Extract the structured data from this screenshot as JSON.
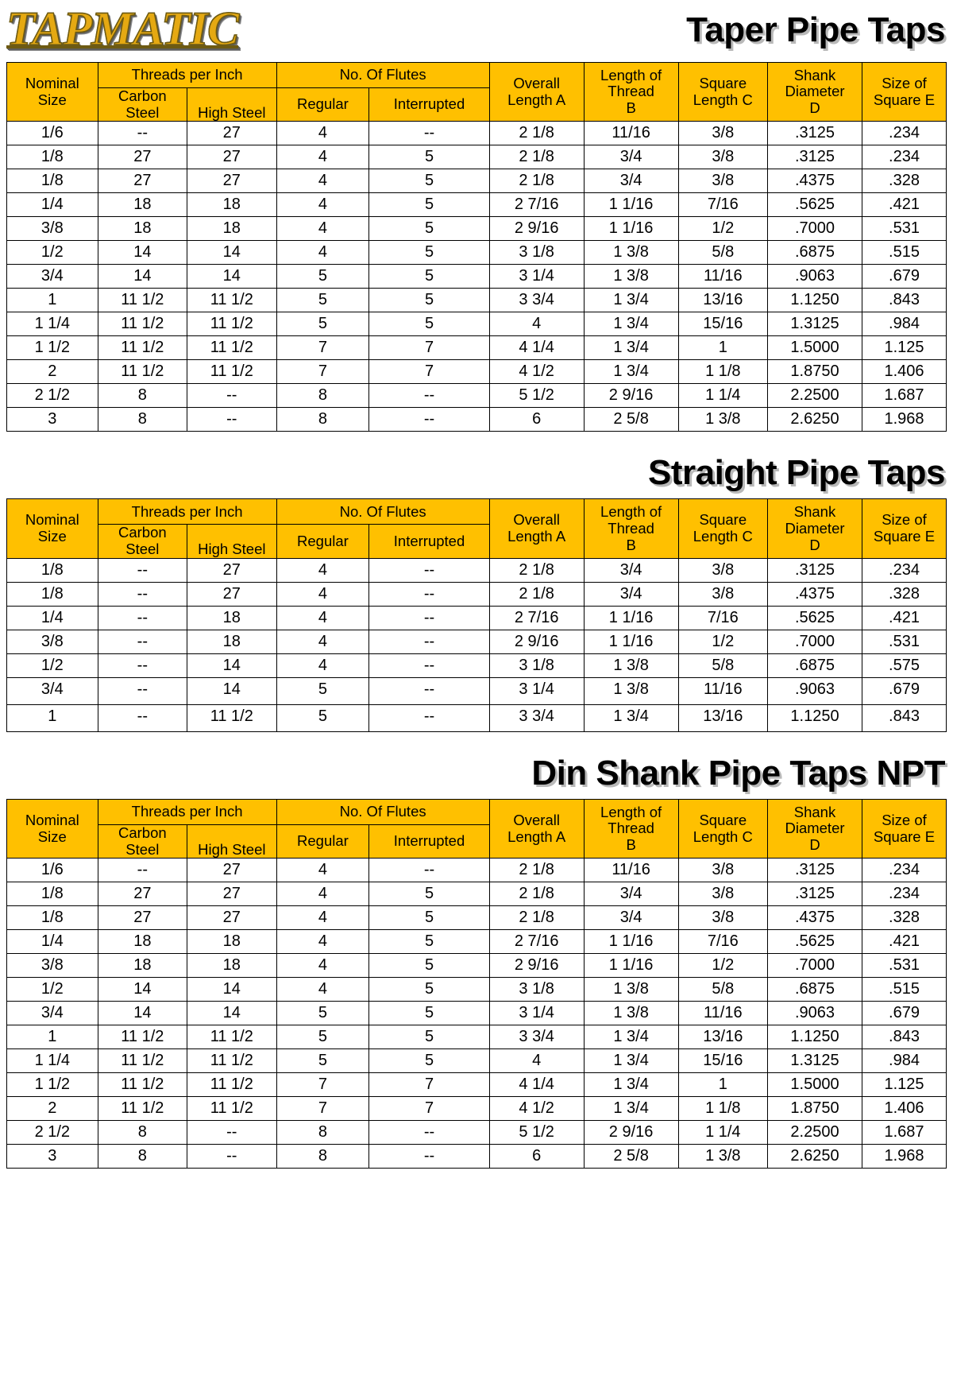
{
  "brand": {
    "logo_text": "TAPMATIC"
  },
  "columns": {
    "nominal_size": "Nominal\nSize",
    "nominal_size_l1": "Nominal",
    "nominal_size_l2": "Size",
    "threads_per_inch": "Threads per Inch",
    "carbon_steel_l1": "Carbon",
    "carbon_steel_l2": "Steel",
    "high_steel": "High Steel",
    "no_of_flutes": "No. Of Flutes",
    "regular": "Regular",
    "interrupted": "Interrupted",
    "overall_l1": "Overall",
    "overall_l2": "Length A",
    "thread_l1": "Length of",
    "thread_l2": "Thread",
    "thread_l3": "B",
    "square_l1": "Square",
    "square_l2": "Length C",
    "shank_l1": "Shank",
    "shank_l2": "Diameter",
    "shank_l3": "D",
    "sqe_l1": "Size of",
    "sqe_l2": "Square E"
  },
  "colors": {
    "header_bg": "#FFC000",
    "shaded_row": "#AFAFAF",
    "logo_gold": "#E5A912",
    "text": "#000000"
  },
  "sections": [
    {
      "id": "taper-pipe-taps",
      "title": "Taper Pipe Taps",
      "rows": [
        {
          "shaded": false,
          "cells": [
            "1/6",
            "--",
            "27",
            "4",
            "--",
            "2 1/8",
            "11/16",
            "3/8",
            ".3125",
            ".234"
          ]
        },
        {
          "shaded": false,
          "cells": [
            "1/8",
            "27",
            "27",
            "4",
            "5",
            "2 1/8",
            "3/4",
            "3/8",
            ".3125",
            ".234"
          ]
        },
        {
          "shaded": true,
          "cells": [
            "1/8",
            "27",
            "27",
            "4",
            "5",
            "2 1/8",
            "3/4",
            "3/8",
            ".4375",
            ".328"
          ]
        },
        {
          "shaded": true,
          "cells": [
            "1/4",
            "18",
            "18",
            "4",
            "5",
            "2 7/16",
            "1 1/16",
            "7/16",
            ".5625",
            ".421"
          ]
        },
        {
          "shaded": false,
          "cells": [
            "3/8",
            "18",
            "18",
            "4",
            "5",
            "2 9/16",
            "1 1/16",
            "1/2",
            ".7000",
            ".531"
          ]
        },
        {
          "shaded": false,
          "cells": [
            "1/2",
            "14",
            "14",
            "4",
            "5",
            "3 1/8",
            "1 3/8",
            "5/8",
            ".6875",
            ".515"
          ]
        },
        {
          "shaded": true,
          "cells": [
            "3/4",
            "14",
            "14",
            "5",
            "5",
            "3 1/4",
            "1 3/8",
            "11/16",
            ".9063",
            ".679"
          ]
        },
        {
          "shaded": true,
          "cells": [
            "1",
            "11 1/2",
            "11 1/2",
            "5",
            "5",
            "3 3/4",
            "1 3/4",
            "13/16",
            "1.1250",
            ".843"
          ]
        },
        {
          "shaded": false,
          "cells": [
            "1 1/4",
            "11 1/2",
            "11 1/2",
            "5",
            "5",
            "4",
            "1 3/4",
            "15/16",
            "1.3125",
            ".984"
          ]
        },
        {
          "shaded": false,
          "cells": [
            "1 1/2",
            "11 1/2",
            "11 1/2",
            "7",
            "7",
            "4 1/4",
            "1 3/4",
            "1",
            "1.5000",
            "1.125"
          ]
        },
        {
          "shaded": true,
          "cells": [
            "2",
            "11 1/2",
            "11 1/2",
            "7",
            "7",
            "4 1/2",
            "1 3/4",
            "1 1/8",
            "1.8750",
            "1.406"
          ]
        },
        {
          "shaded": true,
          "cells": [
            "2 1/2",
            "8",
            "--",
            "8",
            "--",
            "5 1/2",
            "2 9/16",
            "1 1/4",
            "2.2500",
            "1.687"
          ]
        },
        {
          "shaded": false,
          "cells": [
            "3",
            "8",
            "--",
            "8",
            "--",
            "6",
            "2 5/8",
            "1 3/8",
            "2.6250",
            "1.968"
          ]
        }
      ]
    },
    {
      "id": "straight-pipe-taps",
      "title": "Straight Pipe Taps",
      "rows": [
        {
          "shaded": false,
          "cells": [
            "1/8",
            "--",
            "27",
            "4",
            "--",
            "2 1/8",
            "3/4",
            "3/8",
            ".3125",
            ".234"
          ]
        },
        {
          "shaded": false,
          "cells": [
            "1/8",
            "--",
            "27",
            "4",
            "--",
            "2 1/8",
            "3/4",
            "3/8",
            ".4375",
            ".328"
          ]
        },
        {
          "shaded": true,
          "cells": [
            "1/4",
            "--",
            "18",
            "4",
            "--",
            "2 7/16",
            "1 1/16",
            "7/16",
            ".5625",
            ".421"
          ]
        },
        {
          "shaded": true,
          "cells": [
            "3/8",
            "--",
            "18",
            "4",
            "--",
            "2 9/16",
            "1 1/16",
            "1/2",
            ".7000",
            ".531"
          ]
        },
        {
          "shaded": false,
          "cells": [
            "1/2",
            "--",
            "14",
            "4",
            "--",
            "3 1/8",
            "1 3/8",
            "5/8",
            ".6875",
            ".575"
          ]
        },
        {
          "shaded": true,
          "tall": "bottom",
          "cells": [
            "3/4",
            "--",
            "14",
            "5",
            "--",
            "3 1/4",
            "1 3/8",
            "11/16",
            ".9063",
            ".679"
          ]
        },
        {
          "shaded": true,
          "tall": "bottom",
          "cells": [
            "1",
            "--",
            "11 1/2",
            "5",
            "--",
            "3 3/4",
            "1 3/4",
            "13/16",
            "1.1250",
            ".843"
          ]
        }
      ]
    },
    {
      "id": "din-shank-pipe-taps-npt",
      "title": "Din Shank Pipe Taps NPT",
      "rows": [
        {
          "shaded": false,
          "cells": [
            "1/6",
            "--",
            "27",
            "4",
            "--",
            "2 1/8",
            "11/16",
            "3/8",
            ".3125",
            ".234"
          ]
        },
        {
          "shaded": false,
          "cells": [
            "1/8",
            "27",
            "27",
            "4",
            "5",
            "2 1/8",
            "3/4",
            "3/8",
            ".3125",
            ".234"
          ]
        },
        {
          "shaded": true,
          "cells": [
            "1/8",
            "27",
            "27",
            "4",
            "5",
            "2 1/8",
            "3/4",
            "3/8",
            ".4375",
            ".328"
          ]
        },
        {
          "shaded": true,
          "cells": [
            "1/4",
            "18",
            "18",
            "4",
            "5",
            "2 7/16",
            "1 1/16",
            "7/16",
            ".5625",
            ".421"
          ]
        },
        {
          "shaded": false,
          "cells": [
            "3/8",
            "18",
            "18",
            "4",
            "5",
            "2 9/16",
            "1 1/16",
            "1/2",
            ".7000",
            ".531"
          ]
        },
        {
          "shaded": false,
          "cells": [
            "1/2",
            "14",
            "14",
            "4",
            "5",
            "3 1/8",
            "1 3/8",
            "5/8",
            ".6875",
            ".515"
          ]
        },
        {
          "shaded": true,
          "cells": [
            "3/4",
            "14",
            "14",
            "5",
            "5",
            "3 1/4",
            "1 3/8",
            "11/16",
            ".9063",
            ".679"
          ]
        },
        {
          "shaded": true,
          "cells": [
            "1",
            "11 1/2",
            "11 1/2",
            "5",
            "5",
            "3 3/4",
            "1 3/4",
            "13/16",
            "1.1250",
            ".843"
          ]
        },
        {
          "shaded": false,
          "cells": [
            "1 1/4",
            "11 1/2",
            "11 1/2",
            "5",
            "5",
            "4",
            "1 3/4",
            "15/16",
            "1.3125",
            ".984"
          ]
        },
        {
          "shaded": false,
          "cells": [
            "1 1/2",
            "11 1/2",
            "11 1/2",
            "7",
            "7",
            "4 1/4",
            "1 3/4",
            "1",
            "1.5000",
            "1.125"
          ]
        },
        {
          "shaded": true,
          "cells": [
            "2",
            "11 1/2",
            "11 1/2",
            "7",
            "7",
            "4 1/2",
            "1 3/4",
            "1 1/8",
            "1.8750",
            "1.406"
          ]
        },
        {
          "shaded": true,
          "cells": [
            "2 1/2",
            "8",
            "--",
            "8",
            "--",
            "5 1/2",
            "2 9/16",
            "1 1/4",
            "2.2500",
            "1.687"
          ]
        },
        {
          "shaded": false,
          "cells": [
            "3",
            "8",
            "--",
            "8",
            "--",
            "6",
            "2 5/8",
            "1 3/8",
            "2.6250",
            "1.968"
          ]
        }
      ]
    }
  ]
}
